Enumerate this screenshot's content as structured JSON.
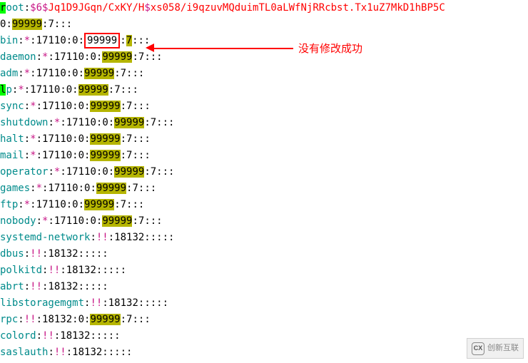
{
  "chart_data": null,
  "annotation": "没有修改成功",
  "watermark": "创新互联",
  "lines": [
    {
      "segments": [
        {
          "t": "r",
          "cls": "lp-hl"
        },
        {
          "t": "oot",
          "cls": "user"
        },
        {
          "t": ":",
          "cls": "colon"
        },
        {
          "t": "$6$",
          "cls": "hash"
        },
        {
          "t": "Jq1D9JGqn/CxKY/H",
          "cls": "red"
        },
        {
          "t": "$",
          "cls": "hash"
        },
        {
          "t": "xs058/i9qzuvMQduimTL0aLWfNjRRcbst.Tx1uZ7MkD1hBP5C",
          "cls": "red"
        }
      ]
    },
    {
      "segments": [
        {
          "t": "0",
          "cls": "num"
        },
        {
          "t": ":",
          "cls": "colon"
        },
        {
          "t": "99999",
          "cls": "hl"
        },
        {
          "t": ":7:::",
          "cls": "colon"
        }
      ]
    },
    {
      "segments": [
        {
          "t": "bin",
          "cls": "user"
        },
        {
          "t": ":",
          "cls": "colon"
        },
        {
          "t": "*",
          "cls": "star"
        },
        {
          "t": ":17110:0:",
          "cls": "colon"
        },
        {
          "t": "99999",
          "cls": "box"
        },
        {
          "t": ":",
          "cls": "colon"
        },
        {
          "t": "7",
          "cls": "hl"
        },
        {
          "t": ":::",
          "cls": "colon"
        }
      ]
    },
    {
      "segments": [
        {
          "t": "daemon",
          "cls": "user"
        },
        {
          "t": ":",
          "cls": "colon"
        },
        {
          "t": "*",
          "cls": "star"
        },
        {
          "t": ":17110:0:",
          "cls": "colon"
        },
        {
          "t": "99999",
          "cls": "hl"
        },
        {
          "t": ":7:::",
          "cls": "colon"
        }
      ]
    },
    {
      "segments": [
        {
          "t": "adm",
          "cls": "user"
        },
        {
          "t": ":",
          "cls": "colon"
        },
        {
          "t": "*",
          "cls": "star"
        },
        {
          "t": ":17110:0:",
          "cls": "colon"
        },
        {
          "t": "99999",
          "cls": "hl"
        },
        {
          "t": ":7:::",
          "cls": "colon"
        }
      ]
    },
    {
      "segments": [
        {
          "t": "l",
          "cls": "lp-hl"
        },
        {
          "t": "p",
          "cls": "user"
        },
        {
          "t": ":",
          "cls": "colon"
        },
        {
          "t": "*",
          "cls": "star"
        },
        {
          "t": ":17110:0:",
          "cls": "colon"
        },
        {
          "t": "99999",
          "cls": "hl"
        },
        {
          "t": ":7:::",
          "cls": "colon"
        }
      ]
    },
    {
      "segments": [
        {
          "t": "sync",
          "cls": "user"
        },
        {
          "t": ":",
          "cls": "colon"
        },
        {
          "t": "*",
          "cls": "star"
        },
        {
          "t": ":17110:0:",
          "cls": "colon"
        },
        {
          "t": "99999",
          "cls": "hl"
        },
        {
          "t": ":7:::",
          "cls": "colon"
        }
      ]
    },
    {
      "segments": [
        {
          "t": "shutdown",
          "cls": "user"
        },
        {
          "t": ":",
          "cls": "colon"
        },
        {
          "t": "*",
          "cls": "star"
        },
        {
          "t": ":17110:0:",
          "cls": "colon"
        },
        {
          "t": "99999",
          "cls": "hl"
        },
        {
          "t": ":7:::",
          "cls": "colon"
        }
      ]
    },
    {
      "segments": [
        {
          "t": "halt",
          "cls": "user"
        },
        {
          "t": ":",
          "cls": "colon"
        },
        {
          "t": "*",
          "cls": "star"
        },
        {
          "t": ":17110:0:",
          "cls": "colon"
        },
        {
          "t": "99999",
          "cls": "hl"
        },
        {
          "t": ":7:::",
          "cls": "colon"
        }
      ]
    },
    {
      "segments": [
        {
          "t": "mail",
          "cls": "user"
        },
        {
          "t": ":",
          "cls": "colon"
        },
        {
          "t": "*",
          "cls": "star"
        },
        {
          "t": ":17110:0:",
          "cls": "colon"
        },
        {
          "t": "99999",
          "cls": "hl"
        },
        {
          "t": ":7:::",
          "cls": "colon"
        }
      ]
    },
    {
      "segments": [
        {
          "t": "operator",
          "cls": "user"
        },
        {
          "t": ":",
          "cls": "colon"
        },
        {
          "t": "*",
          "cls": "star"
        },
        {
          "t": ":17110:0:",
          "cls": "colon"
        },
        {
          "t": "99999",
          "cls": "hl"
        },
        {
          "t": ":7:::",
          "cls": "colon"
        }
      ]
    },
    {
      "segments": [
        {
          "t": "games",
          "cls": "user"
        },
        {
          "t": ":",
          "cls": "colon"
        },
        {
          "t": "*",
          "cls": "star"
        },
        {
          "t": ":17110:0:",
          "cls": "colon"
        },
        {
          "t": "99999",
          "cls": "hl"
        },
        {
          "t": ":7:::",
          "cls": "colon"
        }
      ]
    },
    {
      "segments": [
        {
          "t": "ftp",
          "cls": "user"
        },
        {
          "t": ":",
          "cls": "colon"
        },
        {
          "t": "*",
          "cls": "star"
        },
        {
          "t": ":17110:0:",
          "cls": "colon"
        },
        {
          "t": "99999",
          "cls": "hl"
        },
        {
          "t": ":7:::",
          "cls": "colon"
        }
      ]
    },
    {
      "segments": [
        {
          "t": "nobody",
          "cls": "user"
        },
        {
          "t": ":",
          "cls": "colon"
        },
        {
          "t": "*",
          "cls": "star"
        },
        {
          "t": ":17110:0:",
          "cls": "colon"
        },
        {
          "t": "99999",
          "cls": "hl"
        },
        {
          "t": ":7:::",
          "cls": "colon"
        }
      ]
    },
    {
      "segments": [
        {
          "t": "systemd-network",
          "cls": "user"
        },
        {
          "t": ":",
          "cls": "colon"
        },
        {
          "t": "!!",
          "cls": "star"
        },
        {
          "t": ":18132:::::",
          "cls": "colon"
        }
      ]
    },
    {
      "segments": [
        {
          "t": "dbus",
          "cls": "user"
        },
        {
          "t": ":",
          "cls": "colon"
        },
        {
          "t": "!!",
          "cls": "star"
        },
        {
          "t": ":18132:::::",
          "cls": "colon"
        }
      ]
    },
    {
      "segments": [
        {
          "t": "polkitd",
          "cls": "user"
        },
        {
          "t": ":",
          "cls": "colon"
        },
        {
          "t": "!!",
          "cls": "star"
        },
        {
          "t": ":18132:::::",
          "cls": "colon"
        }
      ]
    },
    {
      "segments": [
        {
          "t": "abrt",
          "cls": "user"
        },
        {
          "t": ":",
          "cls": "colon"
        },
        {
          "t": "!!",
          "cls": "star"
        },
        {
          "t": ":18132:::::",
          "cls": "colon"
        }
      ]
    },
    {
      "segments": [
        {
          "t": "libstoragemgmt",
          "cls": "user"
        },
        {
          "t": ":",
          "cls": "colon"
        },
        {
          "t": "!!",
          "cls": "star"
        },
        {
          "t": ":18132:::::",
          "cls": "colon"
        }
      ]
    },
    {
      "segments": [
        {
          "t": "rpc",
          "cls": "user"
        },
        {
          "t": ":",
          "cls": "colon"
        },
        {
          "t": "!!",
          "cls": "star"
        },
        {
          "t": ":18132:0:",
          "cls": "colon"
        },
        {
          "t": "99999",
          "cls": "hl"
        },
        {
          "t": ":7:::",
          "cls": "colon"
        }
      ]
    },
    {
      "segments": [
        {
          "t": "colord",
          "cls": "user"
        },
        {
          "t": ":",
          "cls": "colon"
        },
        {
          "t": "!!",
          "cls": "star"
        },
        {
          "t": ":18132:::::",
          "cls": "colon"
        }
      ]
    },
    {
      "segments": [
        {
          "t": "saslauth",
          "cls": "user"
        },
        {
          "t": ":",
          "cls": "colon"
        },
        {
          "t": "!!",
          "cls": "star"
        },
        {
          "t": ":18132:::::",
          "cls": "colon"
        }
      ]
    }
  ]
}
